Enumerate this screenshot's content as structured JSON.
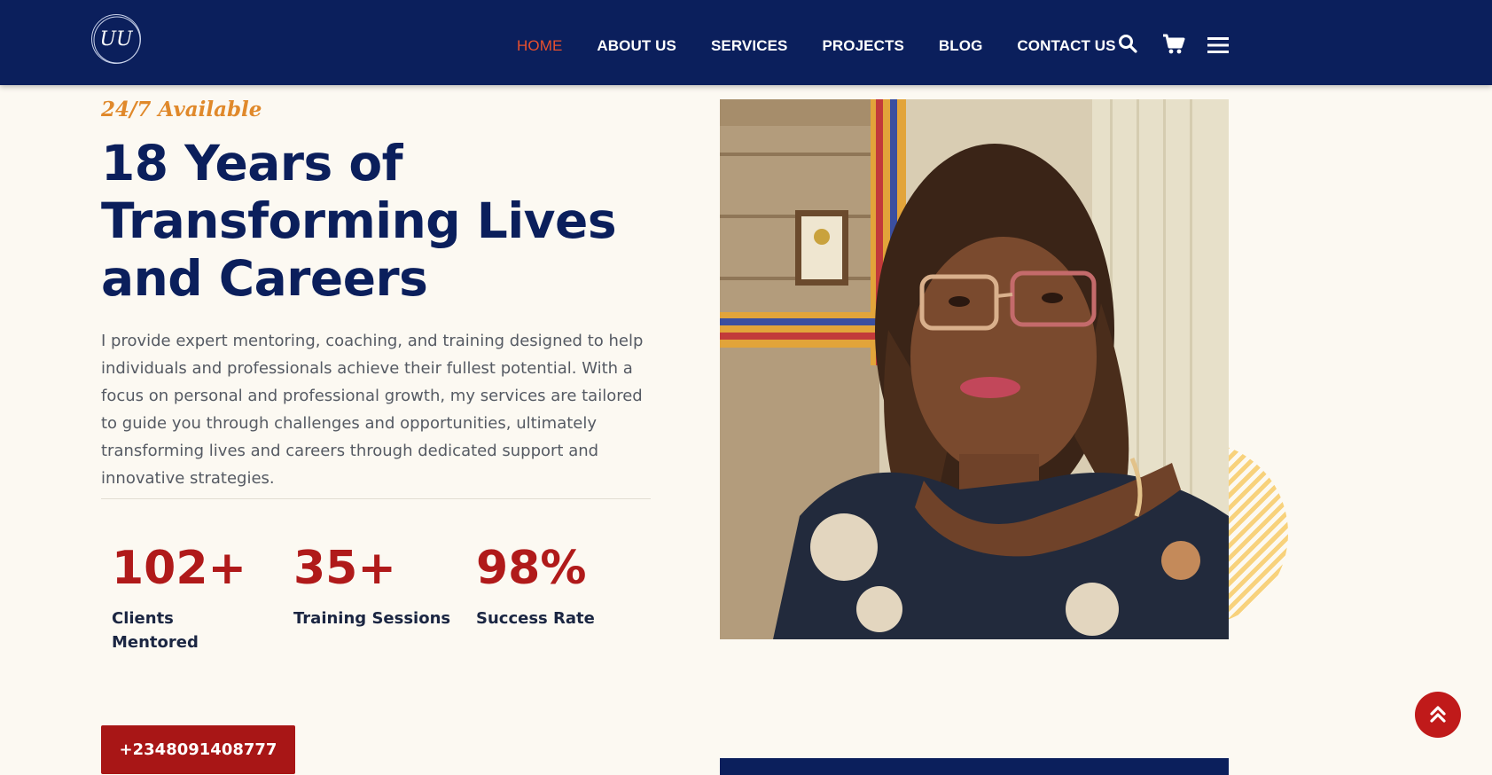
{
  "header": {
    "logo_text": "UU",
    "logo_ring_text": "UZOMA UDUMA",
    "nav": [
      {
        "label": "HOME",
        "active": true
      },
      {
        "label": "ABOUT US",
        "active": false
      },
      {
        "label": "SERVICES",
        "active": false
      },
      {
        "label": "PROJECTS",
        "active": false
      },
      {
        "label": "BLOG",
        "active": false
      },
      {
        "label": "CONTACT US",
        "active": false
      }
    ],
    "icons": [
      "search-icon",
      "cart-icon",
      "menu-icon"
    ]
  },
  "hero": {
    "tagline": "24/7 Available",
    "headline": "18 Years of Transforming Lives and Careers",
    "intro": "I provide expert mentoring, coaching, and training designed to help individuals and professionals achieve their fullest potential. With a focus on personal and professional growth, my services are tailored to guide you through challenges and opportunities, ultimately transforming lives and careers through dedicated support and innovative strategies.",
    "stats": [
      {
        "number": "102+",
        "label": "Clients Mentored"
      },
      {
        "number": "35+",
        "label": "Training Sessions"
      },
      {
        "number": "98%",
        "label": "Success Rate"
      }
    ],
    "phone": "+2348091408777"
  },
  "colors": {
    "navy": "#0b1f5c",
    "accent_red": "#b01a1a",
    "tagline_orange": "#e0892b",
    "active_nav": "#e8502d",
    "background": "#fcf9f2"
  }
}
